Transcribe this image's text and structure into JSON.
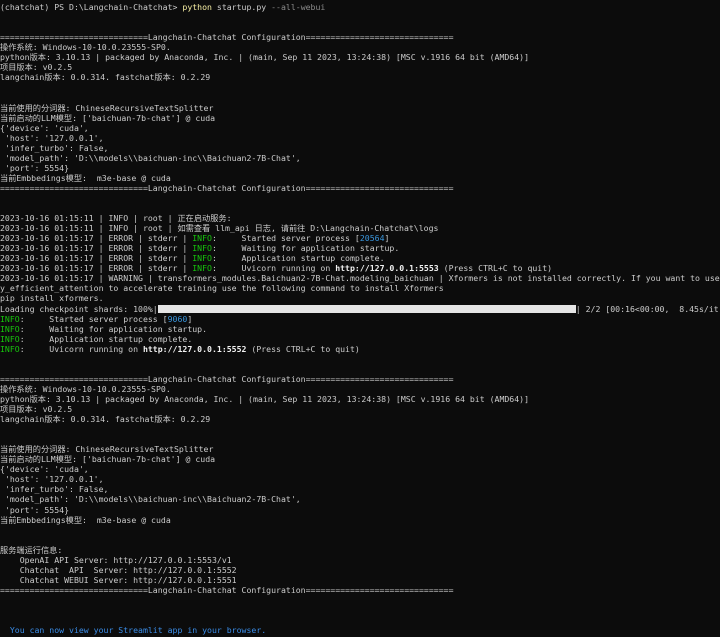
{
  "colors": {
    "background": "#0c0c0c",
    "text": "#cccccc",
    "command": "#f9f1a5",
    "info": "#16c60c",
    "link": "#3b8eea"
  },
  "lines": [
    [
      {
        "t": "(chatchat) PS D:\\Langchain-Chatchat> ",
        "c": "default"
      },
      {
        "t": "python",
        "c": "yellow"
      },
      {
        "t": " startup.py ",
        "c": "default"
      },
      {
        "t": "--all-webui",
        "c": "dim"
      }
    ],
    [],
    [],
    [
      {
        "t": "==============================Langchain-Chatchat Configuration==============================",
        "c": "default"
      }
    ],
    [
      {
        "t": "操作系统: Windows-10-10.0.23555-SP0.",
        "c": "default"
      }
    ],
    [
      {
        "t": "python版本: 3.10.13 | packaged by Anaconda, Inc. | (main, Sep 11 2023, 13:24:38) [MSC v.1916 64 bit (AMD64)]",
        "c": "default"
      }
    ],
    [
      {
        "t": "项目版本: v0.2.5",
        "c": "default"
      }
    ],
    [
      {
        "t": "langchain版本: 0.0.314. fastchat版本: 0.2.29",
        "c": "default"
      }
    ],
    [],
    [],
    [
      {
        "t": "当前使用的分词器: ChineseRecursiveTextSplitter",
        "c": "default"
      }
    ],
    [
      {
        "t": "当前启动的LLM模型: ['baichuan-7b-chat'] @ cuda",
        "c": "default"
      }
    ],
    [
      {
        "t": "{'device': 'cuda',",
        "c": "default"
      }
    ],
    [
      {
        "t": " 'host': '127.0.0.1',",
        "c": "default"
      }
    ],
    [
      {
        "t": " 'infer_turbo': False,",
        "c": "default"
      }
    ],
    [
      {
        "t": " 'model_path': 'D:\\\\models\\\\baichuan-inc\\\\Baichuan2-7B-Chat',",
        "c": "default"
      }
    ],
    [
      {
        "t": " 'port': 5554}",
        "c": "default"
      }
    ],
    [
      {
        "t": "当前Embbedings模型:  m3e-base @ cuda",
        "c": "default"
      }
    ],
    [
      {
        "t": "==============================Langchain-Chatchat Configuration==============================",
        "c": "default"
      }
    ],
    [],
    [],
    [
      {
        "t": "2023-10-16 01:15:11 | INFO | root | 正在启动服务:",
        "c": "default"
      }
    ],
    [
      {
        "t": "2023-10-16 01:15:11 | INFO | root | 如需查看 llm_api 日志, 请前往 D:\\Langchain-Chatchat\\logs",
        "c": "default"
      }
    ],
    [
      {
        "t": "2023-10-16 01:15:17 | ERROR | stderr | ",
        "c": "default"
      },
      {
        "t": "INFO",
        "c": "green"
      },
      {
        "t": ":     Started server process [",
        "c": "default"
      },
      {
        "t": "20564",
        "c": "cyan"
      },
      {
        "t": "]",
        "c": "default"
      }
    ],
    [
      {
        "t": "2023-10-16 01:15:17 | ERROR | stderr | ",
        "c": "default"
      },
      {
        "t": "INFO",
        "c": "green"
      },
      {
        "t": ":     Waiting for application startup.",
        "c": "default"
      }
    ],
    [
      {
        "t": "2023-10-16 01:15:17 | ERROR | stderr | ",
        "c": "default"
      },
      {
        "t": "INFO",
        "c": "green"
      },
      {
        "t": ":     Application startup complete.",
        "c": "default"
      }
    ],
    [
      {
        "t": "2023-10-16 01:15:17 | ERROR | stderr | ",
        "c": "default"
      },
      {
        "t": "INFO",
        "c": "green"
      },
      {
        "t": ":     Uvicorn running on ",
        "c": "default"
      },
      {
        "t": "http://127.0.0.1:5553",
        "c": "white-bold"
      },
      {
        "t": " (Press CTRL+C to quit)",
        "c": "default"
      }
    ],
    [
      {
        "t": "2023-10-16 01:15:17 | WARNING | transformers_modules.Baichuan2-7B-Chat.modeling_baichuan | Xformers is not installed correctly. If you want to use memor",
        "c": "default"
      }
    ],
    [
      {
        "t": "y_efficient_attention to accelerate training use the following command to install Xformers",
        "c": "default"
      }
    ],
    [
      {
        "t": "pip install xformers.",
        "c": "default"
      }
    ],
    [
      {
        "t": "Loading checkpoint shards: 100%|",
        "c": "default"
      },
      {
        "bar": true
      },
      {
        "t": "| 2/2 [00:16<00:00,  8.45s/it]",
        "c": "default"
      }
    ],
    [
      {
        "t": "INFO",
        "c": "green"
      },
      {
        "t": ":     Started server process [",
        "c": "default"
      },
      {
        "t": "9060",
        "c": "cyan"
      },
      {
        "t": "]",
        "c": "default"
      }
    ],
    [
      {
        "t": "INFO",
        "c": "green"
      },
      {
        "t": ":     Waiting for application startup.",
        "c": "default"
      }
    ],
    [
      {
        "t": "INFO",
        "c": "green"
      },
      {
        "t": ":     Application startup complete.",
        "c": "default"
      }
    ],
    [
      {
        "t": "INFO",
        "c": "green"
      },
      {
        "t": ":     Uvicorn running on ",
        "c": "default"
      },
      {
        "t": "http://127.0.0.1:5552",
        "c": "white-bold"
      },
      {
        "t": " (Press CTRL+C to quit)",
        "c": "default"
      }
    ],
    [],
    [],
    [
      {
        "t": "==============================Langchain-Chatchat Configuration==============================",
        "c": "default"
      }
    ],
    [
      {
        "t": "操作系统: Windows-10-10.0.23555-SP0.",
        "c": "default"
      }
    ],
    [
      {
        "t": "python版本: 3.10.13 | packaged by Anaconda, Inc. | (main, Sep 11 2023, 13:24:38) [MSC v.1916 64 bit (AMD64)]",
        "c": "default"
      }
    ],
    [
      {
        "t": "项目版本: v0.2.5",
        "c": "default"
      }
    ],
    [
      {
        "t": "langchain版本: 0.0.314. fastchat版本: 0.2.29",
        "c": "default"
      }
    ],
    [],
    [],
    [
      {
        "t": "当前使用的分词器: ChineseRecursiveTextSplitter",
        "c": "default"
      }
    ],
    [
      {
        "t": "当前启动的LLM模型: ['baichuan-7b-chat'] @ cuda",
        "c": "default"
      }
    ],
    [
      {
        "t": "{'device': 'cuda',",
        "c": "default"
      }
    ],
    [
      {
        "t": " 'host': '127.0.0.1',",
        "c": "default"
      }
    ],
    [
      {
        "t": " 'infer_turbo': False,",
        "c": "default"
      }
    ],
    [
      {
        "t": " 'model_path': 'D:\\\\models\\\\baichuan-inc\\\\Baichuan2-7B-Chat',",
        "c": "default"
      }
    ],
    [
      {
        "t": " 'port': 5554}",
        "c": "default"
      }
    ],
    [
      {
        "t": "当前Embbedings模型:  m3e-base @ cuda",
        "c": "default"
      }
    ],
    [],
    [],
    [
      {
        "t": "服务端运行信息:",
        "c": "default"
      }
    ],
    [
      {
        "t": "    OpenAI API Server: http://127.0.0.1:5553/v1",
        "c": "default"
      }
    ],
    [
      {
        "t": "    Chatchat  API  Server: http://127.0.0.1:5552",
        "c": "default"
      }
    ],
    [
      {
        "t": "    Chatchat WEBUI Server: http://127.0.0.1:5551",
        "c": "default"
      }
    ],
    [
      {
        "t": "==============================Langchain-Chatchat Configuration==============================",
        "c": "default"
      }
    ],
    [],
    [],
    [],
    [
      {
        "t": "  You can now view your Streamlit app in your browser.",
        "c": "blue"
      }
    ]
  ],
  "progress": {
    "fraction": 1.0
  }
}
